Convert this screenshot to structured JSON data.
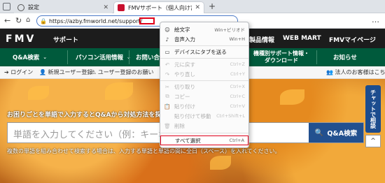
{
  "browser": {
    "tabs": [
      {
        "label": "設定"
      },
      {
        "label": "FMVサポート（個人向け富士通パソコン）"
      }
    ],
    "new_tab": "+",
    "url": "https://azby.fmworld.net/support/",
    "menu_dots": "…"
  },
  "site": {
    "logo": "FMV",
    "section": "サポート",
    "header_links": [
      "製品情報",
      "WEB MART",
      "FMVマイページ"
    ],
    "nav": [
      "Q&A検索",
      "パソコン活用情報",
      "お問い合わせ",
      "機種別サポート情報・",
      "ダウンロード",
      "お知らせ"
    ],
    "login": "ログイン",
    "new_user": "新規ユーザー登録",
    "user_reg": "ユーザー登録のお願い",
    "corporate": "法人のお客様はこちら",
    "search_heading": "お困りごとを単語で入力するとQ&Aから対処方法を探",
    "search_placeholder": "単語を入力してください（例：キーボ",
    "search_button": "Q&A検索",
    "search_note": "複数の単語を組み合わせて検索する場合は、入力する単語と単語の間に全日（スペース）を入れてください。",
    "chat": "チャットで相談",
    "to_top": "^"
  },
  "context_menu": {
    "items": [
      {
        "label": "絵文字",
        "key": "Win+ピリオド",
        "icon": "☺",
        "enabled": true
      },
      {
        "label": "音声入力",
        "key": "Win+H",
        "icon": "♪",
        "enabled": true
      },
      {
        "label": "デバイスにタブを送る",
        "key": "",
        "icon": "▭",
        "enabled": true
      },
      {
        "label": "元に戻す",
        "key": "Ctrl+Z",
        "icon": "↶",
        "enabled": false
      },
      {
        "label": "やり直し",
        "key": "Ctrl+Y",
        "icon": "↷",
        "enabled": false
      },
      {
        "label": "切り取り",
        "key": "Ctrl+X",
        "icon": "✂",
        "enabled": false
      },
      {
        "label": "コピー",
        "key": "Ctrl+C",
        "icon": "⧉",
        "enabled": false
      },
      {
        "label": "貼り付け",
        "key": "Ctrl+V",
        "icon": "📋",
        "enabled": false
      },
      {
        "label": "貼り付けて移動",
        "key": "Ctrl+Shift+L",
        "icon": "",
        "enabled": false
      },
      {
        "label": "削除",
        "key": "",
        "icon": "🗑",
        "enabled": false
      },
      {
        "label": "すべて選択",
        "key": "Ctrl+A",
        "icon": "",
        "enabled": true,
        "highlighted": true
      }
    ]
  },
  "colors": {
    "highlight": "#e0001a",
    "green_nav": "#005a3c",
    "header": "#1c1c1c",
    "button": "#22508f"
  }
}
